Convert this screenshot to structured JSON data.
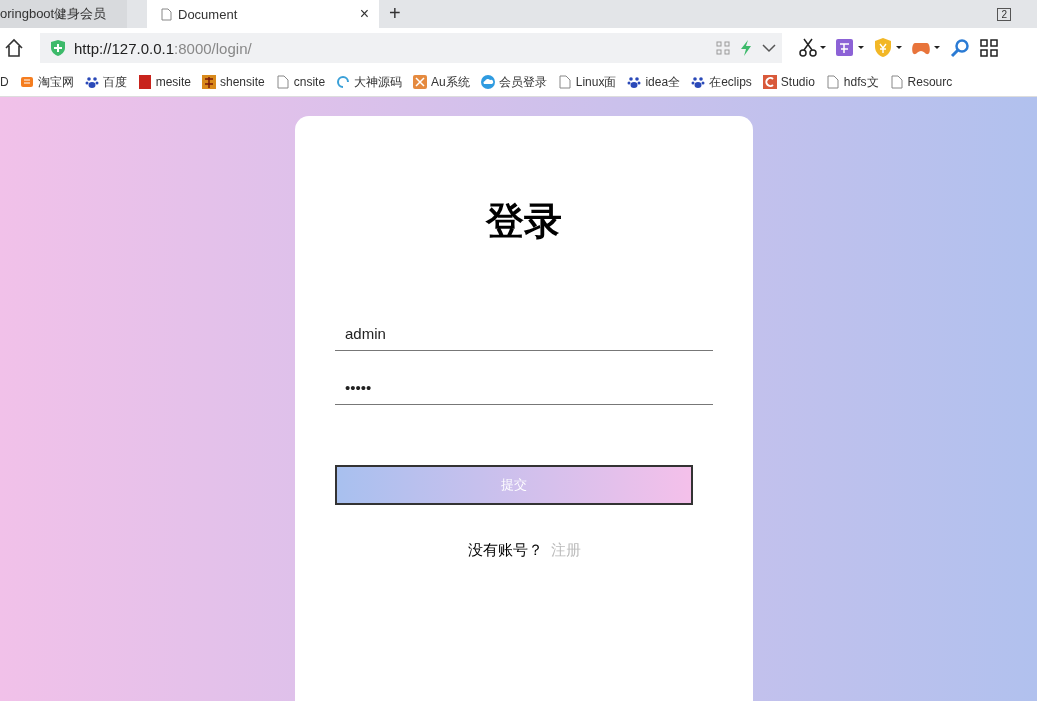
{
  "tabs": [
    {
      "label": "oringboot健身会员",
      "selected": false
    },
    {
      "label": "Document",
      "selected": true,
      "close": "×"
    }
  ],
  "new_tab": "+",
  "window_badge": "2",
  "address_bar": {
    "url_host": "http://127.0.0.1",
    "url_rest": ":8000/login/"
  },
  "bookmarks": [
    {
      "label": "D",
      "kind": "none"
    },
    {
      "label": "淘宝网",
      "kind": "taobao"
    },
    {
      "label": "百度",
      "kind": "paw"
    },
    {
      "label": "mesite",
      "kind": "red"
    },
    {
      "label": "shensite",
      "kind": "shen"
    },
    {
      "label": "cnsite",
      "kind": "page"
    },
    {
      "label": "大神源码",
      "kind": "swirl"
    },
    {
      "label": "Au系统",
      "kind": "au"
    },
    {
      "label": "会员登录",
      "kind": "cloud"
    },
    {
      "label": "Linux面",
      "kind": "page"
    },
    {
      "label": "idea全",
      "kind": "paw"
    },
    {
      "label": "在eclips",
      "kind": "paw"
    },
    {
      "label": "Studio",
      "kind": "studio"
    },
    {
      "label": "hdfs文",
      "kind": "page"
    },
    {
      "label": "Resourc",
      "kind": "page"
    }
  ],
  "login": {
    "title": "登录",
    "username": "admin",
    "password_dots": "•••••",
    "submit": "提交",
    "prompt": "没有账号？",
    "register_link": "注册"
  }
}
